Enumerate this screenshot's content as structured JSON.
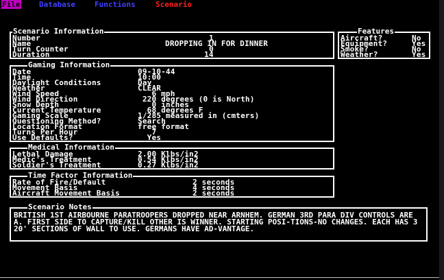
{
  "menu": {
    "items": [
      {
        "label": "File",
        "color": "#000000",
        "bg": "#c000c0"
      },
      {
        "label": "Database",
        "color": "#4040ff"
      },
      {
        "label": "Functions",
        "color": "#4040ff"
      },
      {
        "label": "Scenario",
        "color": "#ff2020"
      }
    ]
  },
  "scenario_info": {
    "title": "Scenario Information",
    "fields": [
      {
        "label": "Number",
        "value": "1"
      },
      {
        "label": "Name",
        "value": "DROPPING IN FOR DINNER"
      },
      {
        "label": "Turn Counter",
        "value": "0"
      },
      {
        "label": "Duration",
        "value": "14"
      }
    ]
  },
  "features": {
    "title": "Features",
    "fields": [
      {
        "label": "Aircraft?",
        "value": "No"
      },
      {
        "label": "Equipment?",
        "value": "Yes"
      },
      {
        "label": "Smoke?",
        "value": "No"
      },
      {
        "label": "Weather?",
        "value": "Yes"
      }
    ]
  },
  "gaming_info": {
    "title": "Gaming Information",
    "fields": [
      {
        "label": "Date",
        "value": "09-10-44"
      },
      {
        "label": "Time",
        "value": "10:00"
      },
      {
        "label": "Daylight Conditions",
        "value": "Day"
      },
      {
        "label": "Weather",
        "value": "CLEAR"
      },
      {
        "label": "Wind Speed",
        "value": "   6 mph"
      },
      {
        "label": "Wind Direction",
        "value": " 220 degrees (0 is North)"
      },
      {
        "label": "Snow Depth",
        "value": "   0 inches"
      },
      {
        "label": "Current Temperature",
        "value": "  68 degrees F"
      },
      {
        "label": "Gaming Scale",
        "value": "1/285 measured in (cmters)"
      },
      {
        "label": "Questioning Method?",
        "value": "Search"
      },
      {
        "label": "Location Format",
        "value": "free format"
      },
      {
        "label": "Turns Per Hour",
        "value": "   7"
      },
      {
        "label": "Use Defaults?",
        "value": "  Yes"
      }
    ]
  },
  "medical_info": {
    "title": "Medical Information",
    "fields": [
      {
        "label": "Lethal Damage",
        "value": "2.00 Klbs/in2"
      },
      {
        "label": "Medic's Treatment",
        "value": "0.54 Klbs/in2"
      },
      {
        "label": "Soldier's Treatment",
        "value": "0.27 Klbs/in2"
      }
    ]
  },
  "time_factor": {
    "title": "Time Factor Information",
    "fields": [
      {
        "label": "Rate of Fire/Default",
        "value": "2 seconds"
      },
      {
        "label": "Movement Basis",
        "value": "4 seconds"
      },
      {
        "label": "Aircraft Movement Basis",
        "value": "2 seconds"
      }
    ]
  },
  "scenario_notes": {
    "title": "Scenario Notes",
    "text": "BRITISH 1ST AIRBOURNE PARATROOPERS DROPPED NEAR ARNHEM. GERMAN 3RD PARA DIV CONTROLS AREA. FIRST SIDE TO CAPTURE/KILL OTHER IS WINNER. STARTING POSI-TIONS-NO CHANGES. EACH HAS 3 20' SECTIONS OF WALL TO USE. GERMANS HAVE AD-VANTAGE."
  }
}
